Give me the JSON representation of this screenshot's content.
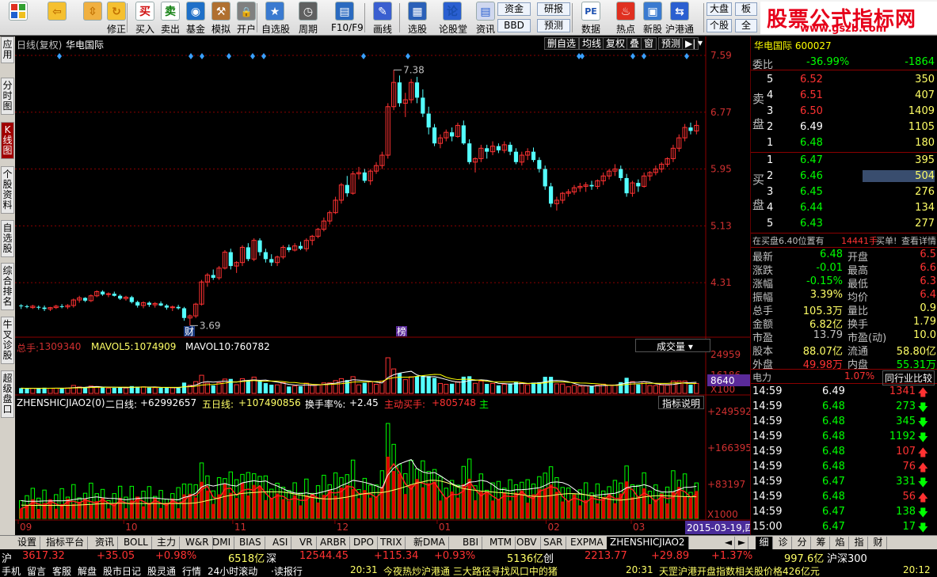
{
  "toolbar": {
    "buttons": [
      {
        "label": "",
        "icon": "windows-logo-icon"
      },
      {
        "label": "",
        "icon": "back-arrow-icon"
      },
      {
        "label": "",
        "icon": "up-down-arrows-icon"
      },
      {
        "label": "修正",
        "icon": "refresh-icon"
      },
      {
        "label": "买入",
        "icon": "buy-icon",
        "glyph": "买"
      },
      {
        "label": "卖出",
        "icon": "sell-icon",
        "glyph": "卖"
      },
      {
        "label": "基金",
        "icon": "fund-icon"
      },
      {
        "label": "模拟",
        "icon": "hammer-icon"
      },
      {
        "label": "开户",
        "icon": "lock-icon"
      },
      {
        "label": "自选股",
        "icon": "star-icon"
      },
      {
        "label": "周期",
        "icon": "clock-icon"
      },
      {
        "label": "F10/F9",
        "icon": "f10-icon"
      },
      {
        "label": "画线",
        "icon": "pen-icon"
      },
      {
        "label": "选股",
        "icon": "select-stock-icon"
      },
      {
        "label": "论股堂",
        "icon": "forum-icon",
        "glyph": "论"
      },
      {
        "label": "资讯",
        "icon": "news-icon"
      },
      {
        "label": "数据",
        "icon": "pe-icon",
        "glyph": "PE"
      },
      {
        "label": "热点",
        "icon": "hot-icon"
      },
      {
        "label": "新股",
        "icon": "new-stock-icon"
      },
      {
        "label": "沪港通",
        "icon": "hk-connect-icon"
      }
    ],
    "boxes": {
      "zijin": "资金",
      "bbd": "BBD",
      "yanbao": "研报",
      "yuce": "预测",
      "dapan": "大盘",
      "gegu": "个股",
      "ban": "板",
      "quan": "全"
    },
    "brand_title": "股票公式指标网",
    "brand_url": "www.gszb.com"
  },
  "left_tabs": [
    {
      "label": "应用",
      "active": false
    },
    {
      "label": "分时图",
      "active": false
    },
    {
      "label": "K线图",
      "active": true
    },
    {
      "label": "个股资料",
      "active": false
    },
    {
      "label": "自选股",
      "active": false
    },
    {
      "label": "综合排名",
      "active": false
    },
    {
      "label": "牛叉诊股",
      "active": false
    },
    {
      "label": "超级盘口",
      "active": false
    }
  ],
  "chart": {
    "title": "日线(复权)",
    "stock_name": "华电国际",
    "top_buttons": [
      "删自选",
      "均线",
      "复权",
      "叠",
      "窗",
      "预测",
      "▶|"
    ],
    "y_axis": [
      "7.59",
      "6.77",
      "5.95",
      "5.13",
      "4.31"
    ],
    "high_label": "7.38",
    "low_label": "3.69",
    "cai_marker": "财",
    "bang_marker": "榜",
    "vol": {
      "zongshou_label": "总手:",
      "zongshou": "1309340",
      "mavol5_label": "MAVOL5:",
      "mavol5": "1074909",
      "mavol10_label": "MAVOL10:",
      "mavol10": "760782",
      "dropdown": "成交量",
      "axis": [
        "24959",
        "16186",
        "X100"
      ],
      "marker": "8640"
    },
    "ind": {
      "name": "ZHENSHICJIAO2(0)",
      "er_label": "二日线:",
      "er_val": "+62992657",
      "wu_label": "五日线:",
      "wu_val": "+107490856",
      "hsl_label": "换手率%:",
      "hsl_val": "+2.45",
      "zd_label": "主动买手:",
      "zd_val": "+805748",
      "extra": "主",
      "help_btn": "指标说明",
      "axis": [
        "+249592",
        "+166395",
        "+83197",
        "X1000"
      ]
    },
    "x_axis": [
      {
        "label": "09",
        "x": 0.0
      },
      {
        "label": "10",
        "x": 0.155
      },
      {
        "label": "11",
        "x": 0.315
      },
      {
        "label": "12",
        "x": 0.465
      },
      {
        "label": "01",
        "x": 0.615
      },
      {
        "label": "02",
        "x": 0.775
      },
      {
        "label": "03",
        "x": 0.9
      }
    ],
    "date_tag": "2015-03-19,四"
  },
  "chart_data": {
    "type": "candlestick",
    "title": "日线(复权) 华电国际",
    "ylim": [
      3.5,
      7.59
    ],
    "ohlc": [
      [
        3.98,
        4.0,
        3.93,
        3.97
      ],
      [
        3.97,
        3.99,
        3.94,
        3.96
      ],
      [
        3.95,
        3.99,
        3.93,
        3.97
      ],
      [
        3.96,
        3.98,
        3.92,
        3.95
      ],
      [
        3.95,
        3.98,
        3.9,
        3.93
      ],
      [
        3.93,
        3.96,
        3.9,
        3.95
      ],
      [
        3.95,
        3.99,
        3.93,
        3.97
      ],
      [
        3.97,
        4.0,
        3.94,
        3.96
      ],
      [
        3.96,
        4.0,
        3.93,
        3.98
      ],
      [
        3.98,
        4.08,
        3.95,
        4.06
      ],
      [
        4.06,
        4.12,
        4.02,
        4.09
      ],
      [
        4.09,
        4.1,
        4.03,
        4.05
      ],
      [
        4.05,
        4.14,
        4.03,
        4.12
      ],
      [
        4.12,
        4.2,
        4.1,
        4.18
      ],
      [
        4.18,
        4.2,
        4.12,
        4.14
      ],
      [
        4.14,
        4.17,
        4.1,
        4.15
      ],
      [
        4.15,
        4.18,
        4.11,
        4.12
      ],
      [
        4.12,
        4.14,
        4.06,
        4.08
      ],
      [
        4.08,
        4.12,
        4.05,
        4.1
      ],
      [
        4.1,
        4.12,
        4.01,
        4.03
      ],
      [
        4.03,
        4.05,
        3.95,
        3.98
      ],
      [
        3.98,
        4.04,
        3.94,
        4.02
      ],
      [
        4.02,
        4.04,
        3.96,
        3.99
      ],
      [
        3.99,
        4.03,
        3.95,
        4.01
      ],
      [
        4.01,
        4.04,
        3.97,
        3.98
      ],
      [
        3.98,
        4.0,
        3.92,
        3.95
      ],
      [
        3.95,
        3.98,
        3.9,
        3.96
      ],
      [
        3.96,
        3.99,
        3.92,
        3.94
      ],
      [
        3.94,
        3.96,
        3.76,
        3.8
      ],
      [
        3.8,
        3.85,
        3.69,
        3.83
      ],
      [
        3.83,
        4.02,
        3.8,
        4.0
      ],
      [
        4.0,
        4.35,
        3.98,
        4.32
      ],
      [
        4.32,
        4.45,
        4.25,
        4.42
      ],
      [
        4.42,
        4.5,
        4.35,
        4.38
      ],
      [
        4.38,
        4.55,
        4.35,
        4.52
      ],
      [
        4.52,
        4.78,
        4.5,
        4.75
      ],
      [
        4.75,
        4.8,
        4.5,
        4.55
      ],
      [
        4.55,
        4.62,
        4.45,
        4.6
      ],
      [
        4.6,
        4.85,
        4.55,
        4.82
      ],
      [
        4.82,
        4.88,
        4.62,
        4.65
      ],
      [
        4.65,
        4.95,
        4.62,
        4.92
      ],
      [
        4.92,
        4.95,
        4.7,
        4.75
      ],
      [
        4.75,
        4.8,
        4.6,
        4.65
      ],
      [
        4.65,
        4.72,
        4.55,
        4.6
      ],
      [
        4.6,
        4.7,
        4.55,
        4.68
      ],
      [
        4.68,
        4.85,
        4.65,
        4.82
      ],
      [
        4.82,
        4.86,
        4.75,
        4.78
      ],
      [
        4.78,
        4.88,
        4.76,
        4.84
      ],
      [
        4.84,
        4.9,
        4.78,
        4.8
      ],
      [
        4.8,
        4.95,
        4.76,
        4.92
      ],
      [
        4.92,
        5.0,
        4.85,
        4.98
      ],
      [
        4.98,
        5.1,
        4.95,
        5.08
      ],
      [
        5.08,
        5.25,
        5.05,
        5.2
      ],
      [
        5.2,
        5.35,
        5.15,
        5.32
      ],
      [
        5.32,
        5.55,
        5.3,
        5.5
      ],
      [
        5.5,
        5.75,
        5.45,
        5.72
      ],
      [
        5.72,
        5.85,
        5.55,
        5.6
      ],
      [
        5.6,
        5.92,
        5.58,
        5.88
      ],
      [
        5.88,
        5.98,
        5.8,
        5.9
      ],
      [
        5.9,
        5.95,
        5.75,
        5.78
      ],
      [
        5.78,
        5.95,
        5.72,
        5.92
      ],
      [
        5.92,
        6.05,
        5.88,
        6.0
      ],
      [
        6.0,
        6.2,
        5.95,
        6.15
      ],
      [
        6.15,
        6.9,
        6.1,
        6.85
      ],
      [
        6.85,
        7.38,
        6.8,
        7.2
      ],
      [
        7.2,
        7.3,
        6.85,
        6.9
      ],
      [
        6.9,
        7.05,
        6.7,
        6.95
      ],
      [
        6.95,
        7.25,
        6.9,
        7.2
      ],
      [
        7.2,
        7.28,
        6.9,
        6.98
      ],
      [
        6.98,
        7.1,
        6.7,
        6.75
      ],
      [
        6.75,
        6.85,
        6.45,
        6.55
      ],
      [
        6.55,
        6.6,
        6.28,
        6.32
      ],
      [
        6.32,
        6.45,
        6.25,
        6.4
      ],
      [
        6.4,
        6.52,
        6.35,
        6.48
      ],
      [
        6.48,
        6.55,
        6.35,
        6.42
      ],
      [
        6.42,
        6.62,
        6.4,
        6.58
      ],
      [
        6.58,
        6.65,
        6.3,
        6.32
      ],
      [
        6.32,
        6.38,
        6.02,
        6.05
      ],
      [
        6.05,
        6.12,
        5.9,
        6.1
      ],
      [
        6.1,
        6.3,
        6.05,
        6.25
      ],
      [
        6.25,
        6.3,
        6.1,
        6.2
      ],
      [
        6.2,
        6.35,
        6.15,
        6.28
      ],
      [
        6.28,
        6.32,
        6.18,
        6.22
      ],
      [
        6.22,
        6.35,
        6.18,
        6.3
      ],
      [
        6.3,
        6.34,
        6.15,
        6.2
      ],
      [
        6.2,
        6.25,
        6.02,
        6.05
      ],
      [
        6.05,
        6.2,
        6.0,
        6.15
      ],
      [
        6.15,
        6.25,
        6.08,
        6.2
      ],
      [
        6.2,
        6.26,
        6.05,
        6.08
      ],
      [
        6.08,
        6.12,
        5.9,
        5.95
      ],
      [
        5.95,
        6.0,
        5.65,
        5.7
      ],
      [
        5.7,
        5.75,
        5.4,
        5.45
      ],
      [
        5.45,
        5.55,
        5.35,
        5.5
      ],
      [
        5.5,
        5.62,
        5.45,
        5.6
      ],
      [
        5.6,
        5.66,
        5.55,
        5.62
      ],
      [
        5.62,
        5.72,
        5.58,
        5.68
      ],
      [
        5.68,
        5.75,
        5.62,
        5.7
      ],
      [
        5.7,
        5.76,
        5.62,
        5.72
      ],
      [
        5.72,
        5.78,
        5.65,
        5.7
      ],
      [
        5.7,
        5.8,
        5.66,
        5.78
      ],
      [
        5.78,
        5.9,
        5.72,
        5.85
      ],
      [
        5.85,
        5.95,
        5.8,
        5.92
      ],
      [
        5.92,
        6.02,
        5.85,
        5.95
      ],
      [
        5.95,
        6.0,
        5.78,
        5.82
      ],
      [
        5.82,
        5.88,
        5.55,
        5.6
      ],
      [
        5.6,
        5.78,
        5.55,
        5.75
      ],
      [
        5.75,
        5.8,
        5.62,
        5.7
      ],
      [
        5.7,
        5.9,
        5.68,
        5.85
      ],
      [
        5.85,
        5.92,
        5.78,
        5.9
      ],
      [
        5.9,
        6.0,
        5.86,
        5.95
      ],
      [
        5.95,
        6.05,
        5.9,
        6.02
      ],
      [
        6.02,
        6.12,
        5.98,
        6.1
      ],
      [
        6.1,
        6.3,
        6.05,
        6.25
      ],
      [
        6.25,
        6.45,
        6.2,
        6.4
      ],
      [
        6.4,
        6.6,
        6.35,
        6.55
      ],
      [
        6.55,
        6.62,
        6.45,
        6.5
      ],
      [
        6.5,
        6.65,
        6.45,
        6.58
      ]
    ],
    "volume": {
      "axis_labels": [
        "24959",
        "16186",
        "X100"
      ],
      "zongshou": 1309340,
      "mavol5": 1074909,
      "mavol10": 760782
    },
    "indicator": {
      "name": "ZHENSHICJIAO2(0)",
      "er_ri_xian": 62992657,
      "wu_ri_xian": 107490856,
      "huan_shou_lv": 2.45,
      "zhu_dong_mai_shou": 805748,
      "axis_labels": [
        "+249592",
        "+166395",
        "+83197",
        "X1000"
      ]
    }
  },
  "right_panel": {
    "header": "华电国际 600027",
    "weibi_label": "委比",
    "weibi": "-36.99%",
    "weicha": "-1864",
    "sell_label": [
      "卖",
      "盘"
    ],
    "buy_label": [
      "买",
      "盘"
    ],
    "sells": [
      {
        "lvl": "5",
        "price": "6.52",
        "vol": "350"
      },
      {
        "lvl": "4",
        "price": "6.51",
        "vol": "407"
      },
      {
        "lvl": "3",
        "price": "6.50",
        "vol": "1409"
      },
      {
        "lvl": "2",
        "price": "6.49",
        "vol": "1105"
      },
      {
        "lvl": "1",
        "price": "6.48",
        "vol": "180"
      }
    ],
    "buys": [
      {
        "lvl": "1",
        "price": "6.47",
        "vol": "395"
      },
      {
        "lvl": "2",
        "price": "6.46",
        "vol": "504"
      },
      {
        "lvl": "3",
        "price": "6.45",
        "vol": "276"
      },
      {
        "lvl": "4",
        "price": "6.44",
        "vol": "134"
      },
      {
        "lvl": "5",
        "price": "6.43",
        "vol": "277"
      }
    ],
    "notice": "在买盘6.40位置有",
    "notice_vol": "14441手",
    "notice_tail": "买单!",
    "notice_link": "查看详情",
    "stats": [
      {
        "l1": "最新",
        "v1": "6.48",
        "l2": "开盘",
        "v2": "6.5"
      },
      {
        "l1": "涨跌",
        "v1": "-0.01",
        "l2": "最高",
        "v2": "6.6"
      },
      {
        "l1": "涨幅",
        "v1": "-0.15%",
        "l2": "最低",
        "v2": "6.3"
      },
      {
        "l1": "振幅",
        "v1": "3.39%",
        "l2": "均价",
        "v2": "6.4"
      },
      {
        "l1": "总手",
        "v1": "105.3万",
        "l2": "量比",
        "v2": "0.9"
      },
      {
        "l1": "金额",
        "v1": "6.82亿",
        "l2": "换手",
        "v2": "1.79"
      },
      {
        "l1": "市盈",
        "v1": "13.79",
        "l2": "市盈(动)",
        "v2": "10.0"
      },
      {
        "l1": "股本",
        "v1": "88.07亿",
        "l2": "流通",
        "v2": "58.80亿"
      },
      {
        "l1": "外盘",
        "v1": "49.98万",
        "l2": "内盘",
        "v2": "55.31万"
      }
    ],
    "sector": "电力",
    "sector_pct": "1.07%",
    "sector_btn": "同行业比较",
    "ticks": [
      {
        "t": "14:59",
        "p": "6.49",
        "v": "1341",
        "d": "up"
      },
      {
        "t": "14:59",
        "p": "6.48",
        "v": "273",
        "d": "down"
      },
      {
        "t": "14:59",
        "p": "6.48",
        "v": "345",
        "d": "down"
      },
      {
        "t": "14:59",
        "p": "6.48",
        "v": "1192",
        "d": "down"
      },
      {
        "t": "14:59",
        "p": "6.48",
        "v": "107",
        "d": "up"
      },
      {
        "t": "14:59",
        "p": "6.48",
        "v": "76",
        "d": "up"
      },
      {
        "t": "14:59",
        "p": "6.47",
        "v": "331",
        "d": "down"
      },
      {
        "t": "14:59",
        "p": "6.48",
        "v": "56",
        "d": "up"
      },
      {
        "t": "14:59",
        "p": "6.47",
        "v": "138",
        "d": "down"
      },
      {
        "t": "15:00",
        "p": "6.47",
        "v": "17",
        "d": "down"
      }
    ]
  },
  "bottom_tabs": [
    "设置",
    "指标平台",
    "资讯",
    "BOLL",
    "主力",
    "W&R",
    "DMI",
    "BIAS",
    "ASI",
    "VR",
    "ARBR",
    "DPO",
    "TRIX",
    "新DMA",
    "BBI",
    "MTM",
    "OBV",
    "SAR",
    "EXPMA",
    "ZHENSHICJIAO2"
  ],
  "bottom_nav": [
    "◄",
    "►"
  ],
  "right_tabs": [
    "细",
    "诊",
    "分",
    "筹",
    "焰",
    "指",
    "财"
  ],
  "status": {
    "sh_label": "沪",
    "sh_idx": "3617.32",
    "sh_chg": "+35.05",
    "sh_pct": "+0.98%",
    "sh_amt": "6518亿",
    "sz_label": "深",
    "sz_idx": "12544.45",
    "sz_chg": "+115.34",
    "sz_pct": "+0.93%",
    "sz_amt": "5136亿",
    "cy_label": "创",
    "cy_idx": "2213.77",
    "cy_chg": "+29.89",
    "cy_pct": "+1.37%",
    "cy_amt": "997.6亿",
    "hs300": "沪深300"
  },
  "marquee": {
    "items": [
      "手机",
      "留言",
      "客服",
      "解盘",
      "股市日记",
      "股灵通",
      "行情",
      "24小时滚动",
      "·读报行"
    ],
    "time1": "20:31",
    "headline1": "今夜热炒沪港通 三大路径寻找风口中的猪",
    "time2": "20:31",
    "headline2": "天罡沪港开盘指数相关股价格426亿元",
    "time3": "20:12"
  },
  "colors": {
    "up": "#ff3232",
    "down": "#54ffff",
    "bg": "#000000",
    "grid": "#8b0000",
    "ma5": "#ffffff",
    "ma10": "#ffff00",
    "green": "#00ff00",
    "yellow": "#ffff00"
  }
}
